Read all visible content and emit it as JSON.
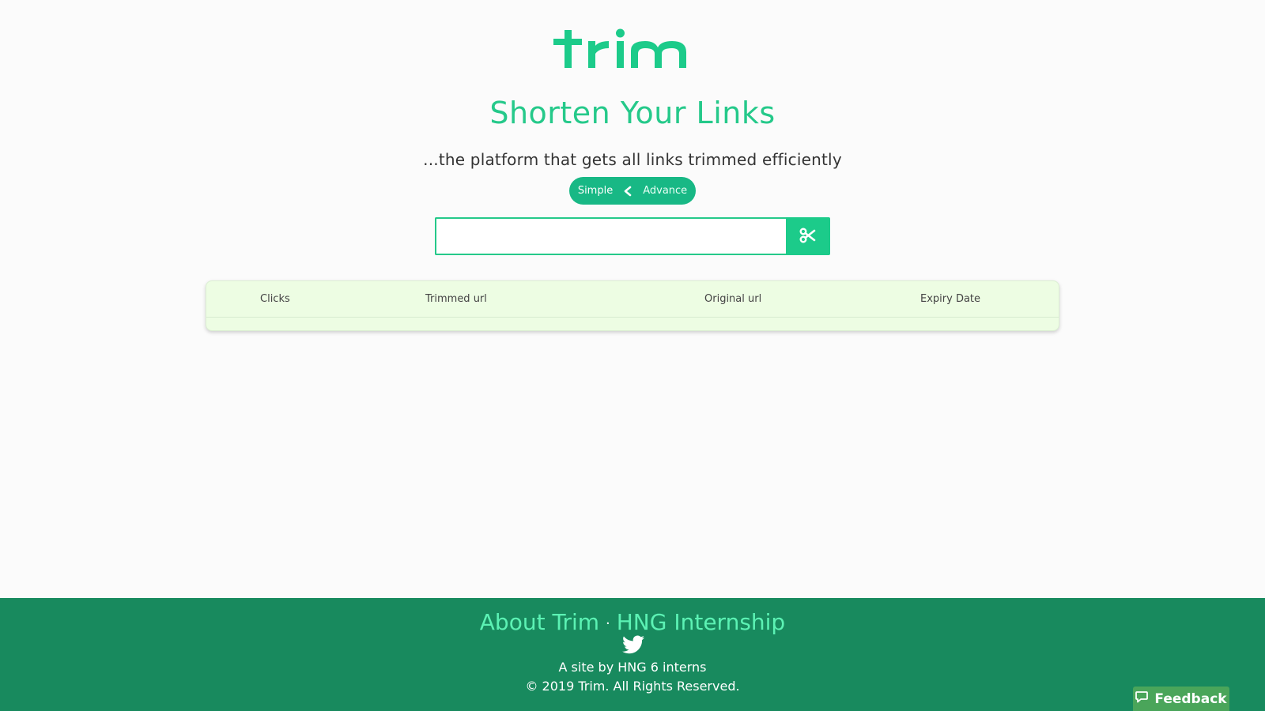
{
  "brand": {
    "logo_text": "trim",
    "accent": "#1ccb8a",
    "footer_bg": "#188a5e"
  },
  "hero": {
    "title": "Shorten Your Links",
    "subtitle": "...the platform that gets all links trimmed efficiently"
  },
  "mode_toggle": {
    "simple_label": "Simple",
    "advance_label": "Advance",
    "icon": "chevron-left-icon"
  },
  "shorten_form": {
    "input_value": "",
    "input_placeholder": "",
    "submit_icon": "scissors-icon"
  },
  "links_table": {
    "columns": [
      "Clicks",
      "Trimmed url",
      "Original url",
      "Expiry Date"
    ],
    "rows": []
  },
  "footer": {
    "about_link": "About Trim",
    "separator": "·",
    "hng_link": "HNG Internship",
    "social_icon": "twitter-icon",
    "credit": "A site by HNG 6 interns",
    "copyright": "© 2019 Trim. All Rights Reserved."
  },
  "feedback": {
    "label": "Feedback",
    "icon": "comment-icon"
  }
}
